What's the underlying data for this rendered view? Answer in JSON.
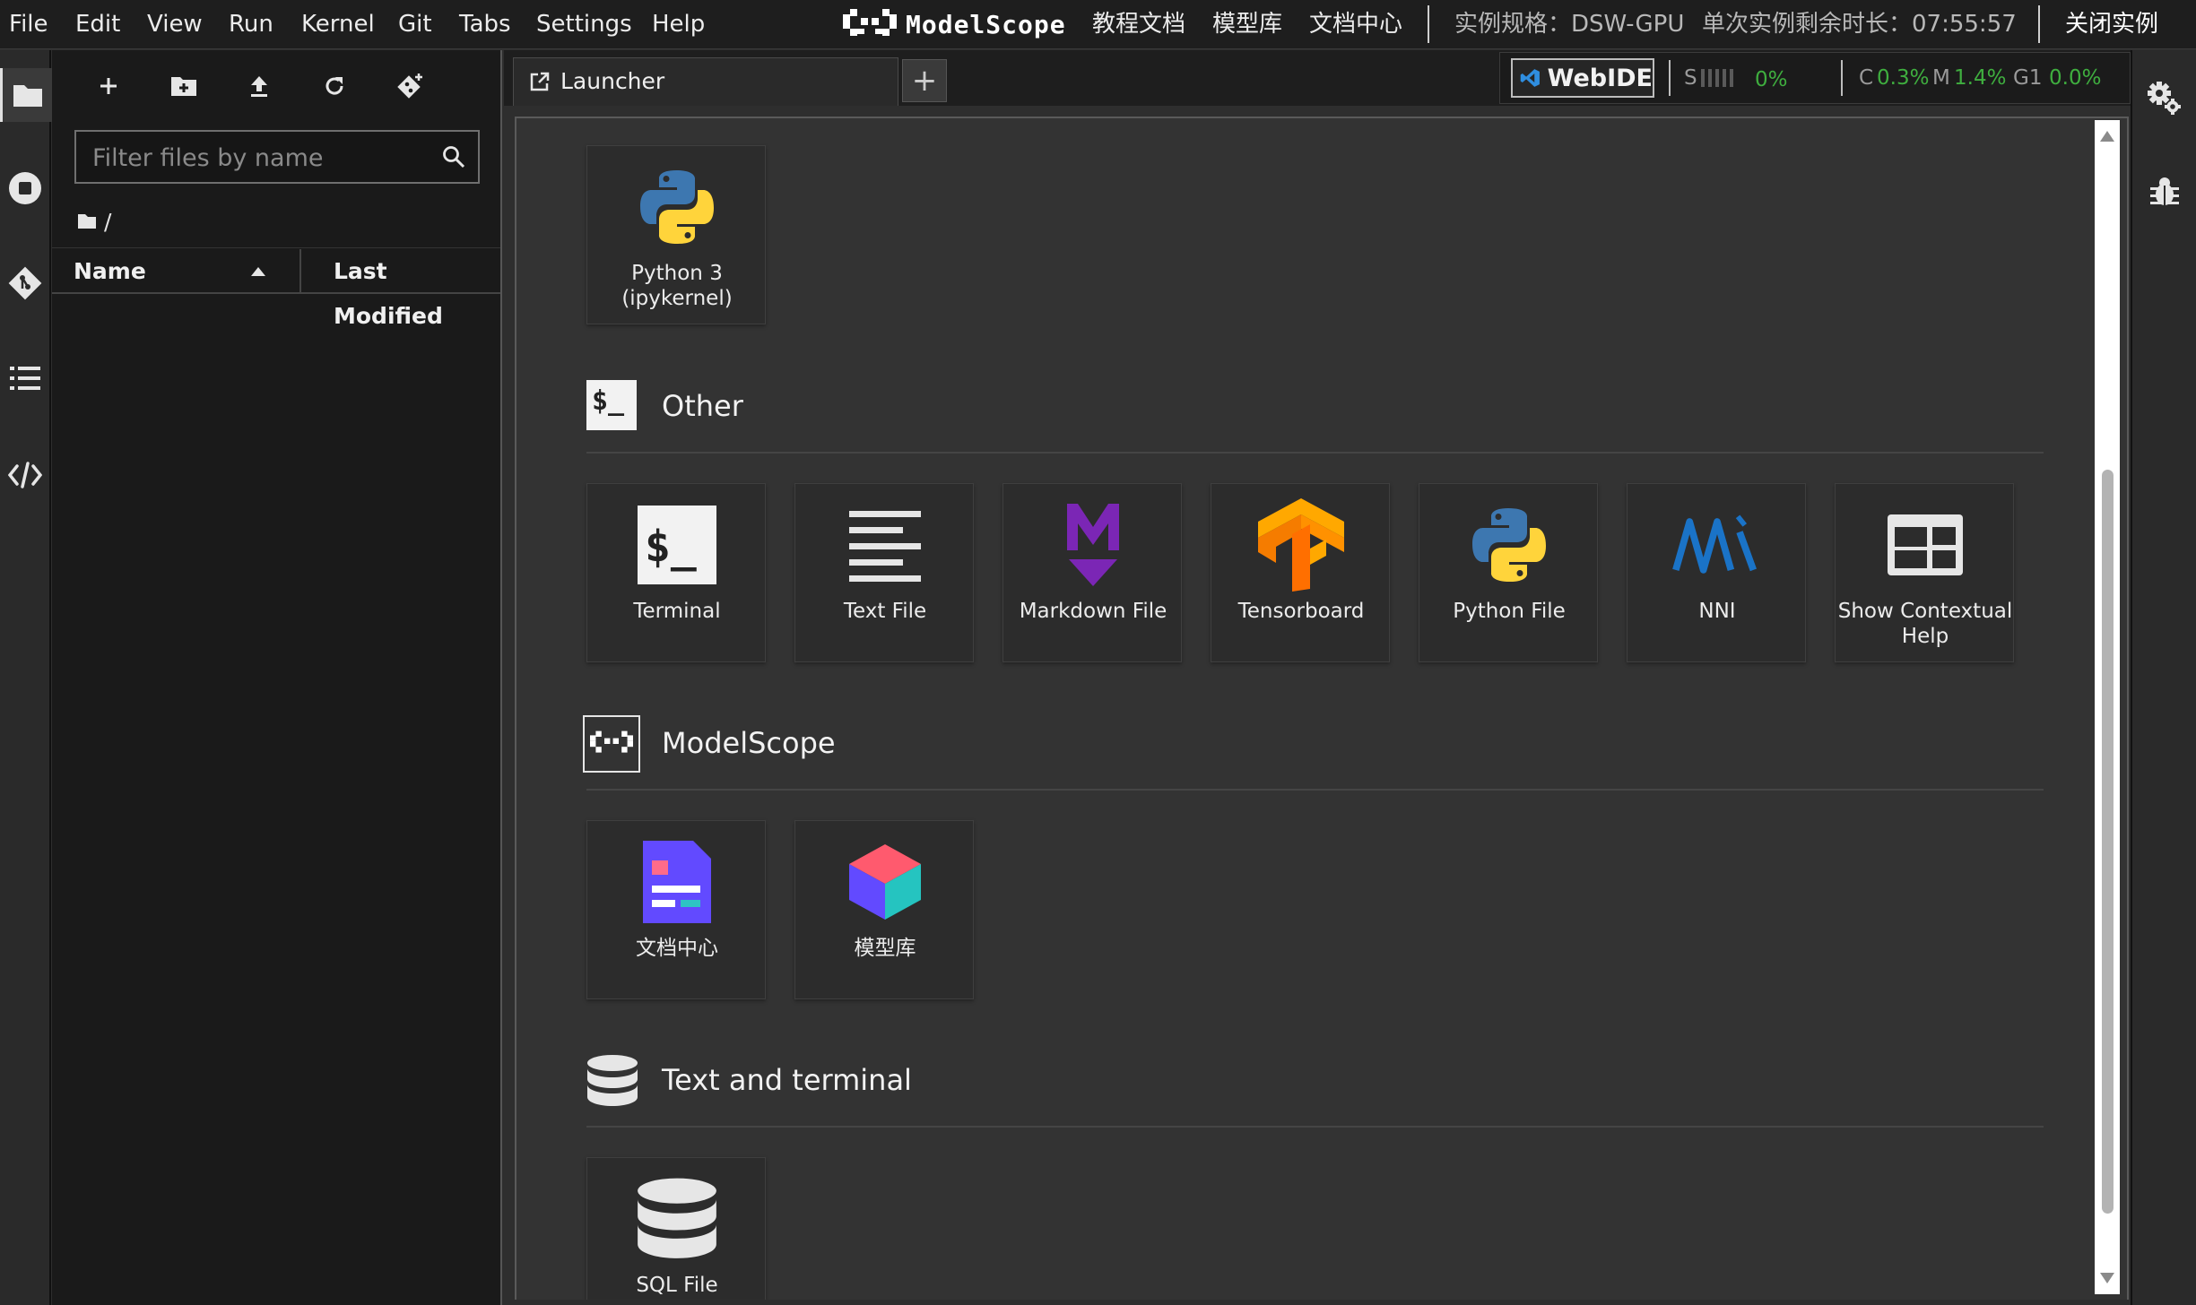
{
  "menubar": {
    "items": [
      "File",
      "Edit",
      "View",
      "Run",
      "Kernel",
      "Git",
      "Tabs",
      "Settings",
      "Help"
    ],
    "brand": "ModelScope",
    "links": [
      "教程文档",
      "模型库",
      "文档中心"
    ],
    "instance_spec": "实例规格：DSW-GPU",
    "remaining_time": "单次实例剩余时长：07:55:57",
    "close_instance": "关闭实例"
  },
  "file_browser": {
    "filter_placeholder": "Filter files by name",
    "path": "/",
    "col_name": "Name",
    "col_modified": "Last Modified"
  },
  "tabs": {
    "launcher_label": "Launcher",
    "add_label": "+"
  },
  "status": {
    "webide_label": "WebIDE",
    "s_label": "S",
    "s_value": "0%",
    "c_label": "C",
    "c_value": "0.3%",
    "m_label": "M",
    "m_value": "1.4%",
    "g_label": "G1",
    "g_value": "0.0%",
    "ok_color": "#3fae3f"
  },
  "launcher": {
    "notebook": {
      "python3_line1": "Python 3",
      "python3_line2": "(ipykernel)"
    },
    "sections": {
      "other": "Other",
      "modelscope": "ModelScope",
      "text_terminal": "Text and terminal"
    },
    "other_items": [
      "Terminal",
      "Text File",
      "Markdown File",
      "Tensorboard",
      "Python File",
      "NNI"
    ],
    "contextual_help_line1": "Show Contextual",
    "contextual_help_line2": "Help",
    "modelscope_items": [
      "文档中心",
      "模型库"
    ],
    "text_items": [
      "SQL File"
    ]
  }
}
